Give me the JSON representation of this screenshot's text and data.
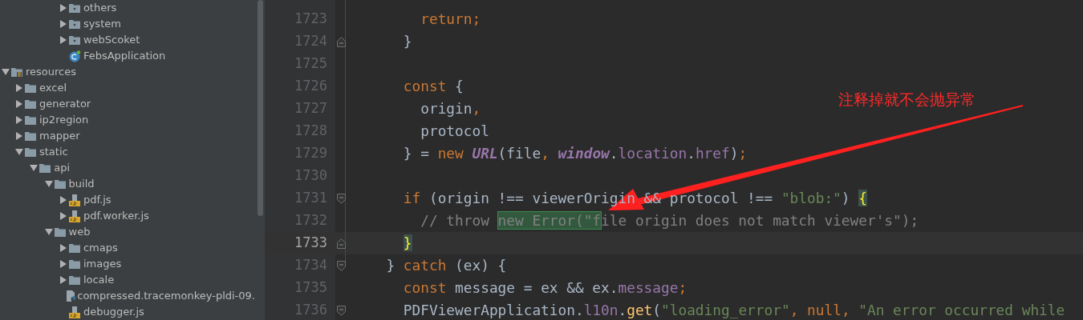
{
  "project_tree": [
    {
      "children": [
        {
          "children": [
            {
              "children": [
                {
                  "children": [
                    {
                      "label": "others",
                      "kind": "package",
                      "expanded": false
                    },
                    {
                      "label": "system",
                      "kind": "package",
                      "expanded": false
                    },
                    {
                      "label": "webScoket",
                      "kind": "package",
                      "expanded": false
                    },
                    {
                      "label": "FebsApplication",
                      "kind": "app-class"
                    }
                  ]
                }
              ]
            }
          ]
        }
      ]
    },
    {
      "label": "resources",
      "kind": "resources-folder",
      "expanded": true,
      "children": [
        {
          "label": "excel",
          "kind": "folder",
          "expanded": false
        },
        {
          "label": "generator",
          "kind": "folder",
          "expanded": false
        },
        {
          "label": "ip2region",
          "kind": "folder",
          "expanded": false
        },
        {
          "label": "mapper",
          "kind": "folder",
          "expanded": false
        },
        {
          "label": "static",
          "kind": "folder",
          "expanded": true,
          "children": [
            {
              "label": "api",
              "kind": "folder",
              "expanded": true,
              "children": [
                {
                  "label": "build",
                  "kind": "folder",
                  "expanded": true,
                  "children": [
                    {
                      "label": "pdf.js",
                      "kind": "js",
                      "expanded": false
                    },
                    {
                      "label": "pdf.worker.js",
                      "kind": "js",
                      "expanded": false
                    }
                  ]
                },
                {
                  "label": "web",
                  "kind": "folder",
                  "expanded": true,
                  "children": [
                    {
                      "label": "cmaps",
                      "kind": "folder",
                      "expanded": false
                    },
                    {
                      "label": "images",
                      "kind": "folder",
                      "expanded": false
                    },
                    {
                      "label": "locale",
                      "kind": "folder",
                      "expanded": false
                    },
                    {
                      "label": "compressed.tracemonkey-pldi-09.",
                      "kind": "unknown"
                    },
                    {
                      "label": "debugger.js",
                      "kind": "js"
                    }
                  ]
                }
              ]
            }
          ]
        }
      ]
    }
  ],
  "editor": {
    "lines": [
      {
        "number": "1723",
        "current": false,
        "kind": "plain",
        "tokens": [
          {
            "text": "      return;",
            "kind": "keyword"
          }
        ]
      },
      {
        "number": "1724",
        "current": false,
        "kind": "fold-end",
        "tokens": [
          {
            "text": "    }",
            "kind": "plain"
          }
        ]
      },
      {
        "number": "1725",
        "current": false,
        "kind": "plain"
      },
      {
        "number": "1726",
        "current": false,
        "kind": "plain",
        "tokens": [
          {
            "text": "    const",
            "kind": "keyword"
          },
          {
            "text": " {",
            "kind": "plain"
          }
        ]
      },
      {
        "number": "1727",
        "current": false,
        "kind": "plain",
        "tokens": [
          {
            "text": "      origin",
            "kind": "plain"
          },
          {
            "text": ",",
            "kind": "keyword"
          }
        ]
      },
      {
        "number": "1728",
        "current": false,
        "kind": "plain",
        "tokens": [
          {
            "text": "      protocol",
            "kind": "plain"
          }
        ]
      },
      {
        "number": "1729",
        "current": false,
        "kind": "plain",
        "tokens": [
          {
            "text": "    } = ",
            "kind": "plain"
          },
          {
            "text": "new ",
            "kind": "keyword"
          },
          {
            "text": "URL",
            "kind": "class"
          },
          {
            "text": "(file",
            "kind": "plain"
          },
          {
            "text": ", ",
            "kind": "keyword"
          },
          {
            "text": "window",
            "kind": "global"
          },
          {
            "text": ".",
            "kind": "plain"
          },
          {
            "text": "location",
            "kind": "property"
          },
          {
            "text": ".",
            "kind": "plain"
          },
          {
            "text": "href",
            "kind": "property"
          },
          {
            "text": ")",
            "kind": "plain"
          },
          {
            "text": ";",
            "kind": "keyword"
          }
        ]
      },
      {
        "number": "1730",
        "current": false,
        "kind": "plain"
      },
      {
        "number": "1731",
        "current": false,
        "kind": "fold-start",
        "tokens": [
          {
            "text": "    if",
            "kind": "keyword"
          },
          {
            "text": " (origin !== viewerOrigin && protocol !== ",
            "kind": "plain"
          },
          {
            "text": "\"blob:\"",
            "kind": "string"
          },
          {
            "text": ") ",
            "kind": "plain"
          },
          {
            "text": "{",
            "kind": "brace-match"
          }
        ]
      },
      {
        "number": "1732",
        "current": false,
        "kind": "plain",
        "tokens": [
          {
            "text": "      // throw ",
            "kind": "comment"
          },
          {
            "text": "new Error(\"f",
            "kind": "comment-found"
          },
          {
            "text": "ile origin does not match viewer's\");",
            "kind": "comment"
          }
        ]
      },
      {
        "number": "1733",
        "current": true,
        "kind": "fold-end",
        "tokens": [
          {
            "text": "    }",
            "kind": "brace-match"
          }
        ]
      },
      {
        "number": "1734",
        "current": false,
        "kind": "fold-start",
        "tokens": [
          {
            "text": "  } ",
            "kind": "plain"
          },
          {
            "text": "catch",
            "kind": "keyword"
          },
          {
            "text": " (ex) {",
            "kind": "plain"
          }
        ]
      },
      {
        "number": "1735",
        "current": false,
        "kind": "plain",
        "tokens": [
          {
            "text": "    const",
            "kind": "keyword"
          },
          {
            "text": " message = ex && ex.",
            "kind": "plain"
          },
          {
            "text": "message",
            "kind": "property"
          },
          {
            "text": ";",
            "kind": "keyword"
          }
        ]
      },
      {
        "number": "1736",
        "current": false,
        "kind": "fold-start",
        "tokens": [
          {
            "text": "    PDFViewerApplication.",
            "kind": "plain"
          },
          {
            "text": "l10n",
            "kind": "property"
          },
          {
            "text": ".",
            "kind": "plain"
          },
          {
            "text": "get",
            "kind": "method"
          },
          {
            "text": "(",
            "kind": "plain"
          },
          {
            "text": "\"loading_error\"",
            "kind": "string"
          },
          {
            "text": ", ",
            "kind": "keyword"
          },
          {
            "text": "null",
            "kind": "keyword"
          },
          {
            "text": ", ",
            "kind": "keyword"
          },
          {
            "text": "\"An error occurred while",
            "kind": "string"
          }
        ]
      }
    ]
  },
  "annotation": {
    "text": "注释掉就不会抛异常"
  }
}
